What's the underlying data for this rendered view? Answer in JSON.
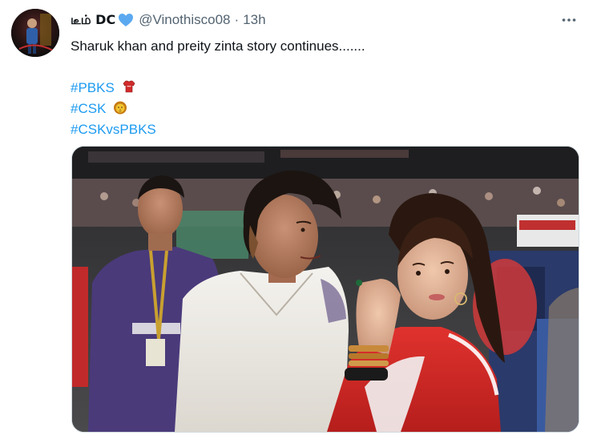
{
  "author": {
    "display_name": "டீம் DC",
    "handle": "@Vinothisco08",
    "separator": "·",
    "time": "13h",
    "avatar_icon": "avatar-photo",
    "badge_icon": "blue-heart-icon",
    "badge_color": "#5aa9f0"
  },
  "tweet": {
    "text": "Sharuk khan and preity zinta story continues.......",
    "hashtags": [
      {
        "tag": "#PBKS",
        "emoji": "red-jersey-emoji"
      },
      {
        "tag": "#CSK",
        "emoji": "lion-emoji"
      },
      {
        "tag": "#CSKvsPBKS",
        "emoji": ""
      }
    ],
    "hashtag_color": "#1d9bf0"
  },
  "more_menu": {
    "icon": "more-horizontal-icon"
  },
  "media": {
    "type": "photo"
  }
}
